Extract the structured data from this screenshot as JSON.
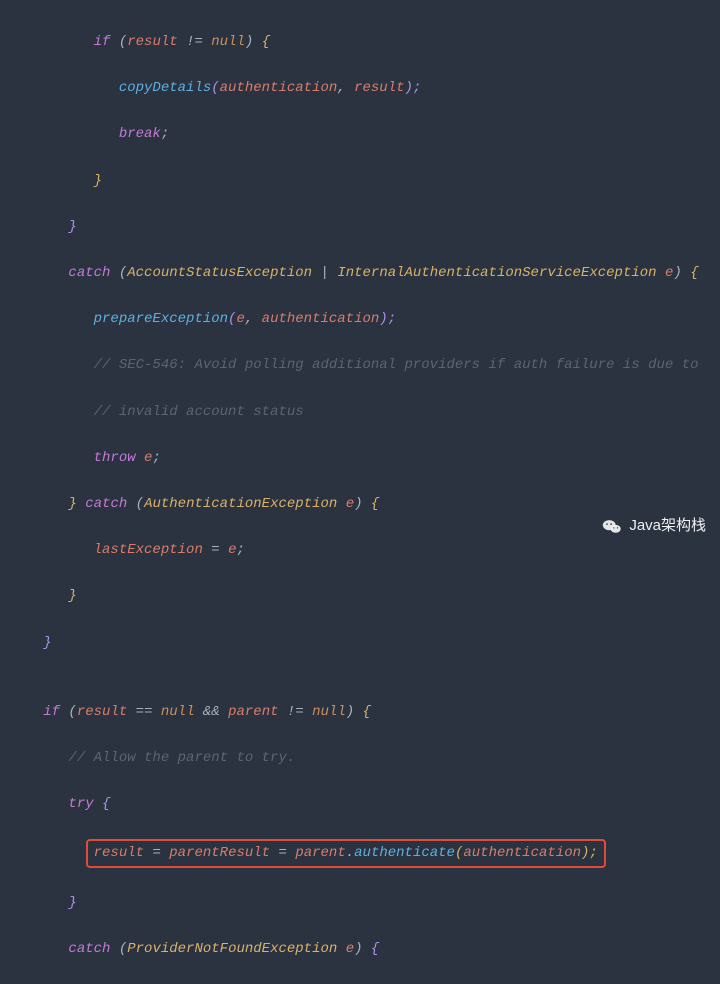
{
  "lines": {
    "l1": {
      "indent": 3,
      "kw": "if",
      "open": " (",
      "v1": "result",
      "op": " != ",
      "lit": "null",
      "close": ") ",
      "brace": "{"
    },
    "l2": {
      "indent": 4,
      "fn": "copyDetails",
      "open": "(",
      "a1": "authentication",
      "c": ", ",
      "a2": "result",
      "close": ");"
    },
    "l3": {
      "indent": 4,
      "kw": "break",
      "semi": ";"
    },
    "l4": {
      "indent": 3,
      "brace": "}"
    },
    "l5": {
      "indent": 2,
      "brace": "}"
    },
    "l6": {
      "indent": 2,
      "kw": "catch",
      "open": " (",
      "t1": "AccountStatusException",
      "pipe": " | ",
      "t2": "InternalAuthenticationServiceException",
      "sp": " ",
      "v": "e",
      "close": ") ",
      "brace": "{"
    },
    "l7": {
      "indent": 3,
      "fn": "prepareException",
      "open": "(",
      "a1": "e",
      "c": ", ",
      "a2": "authentication",
      "close": ");"
    },
    "l8": {
      "indent": 3,
      "cmt": "// SEC-546: Avoid polling additional providers if auth failure is due to"
    },
    "l9": {
      "indent": 3,
      "cmt": "// invalid account status"
    },
    "l10": {
      "indent": 3,
      "kw": "throw",
      "sp": " ",
      "v": "e",
      "semi": ";"
    },
    "l11": {
      "indent": 2,
      "cb": "}",
      "sp": " ",
      "kw": "catch",
      "open": " (",
      "t": "AuthenticationException",
      "sp2": " ",
      "v": "e",
      "close": ") ",
      "ob": "{"
    },
    "l12": {
      "indent": 3,
      "v1": "lastException",
      "op": " = ",
      "v2": "e",
      "semi": ";"
    },
    "l13": {
      "indent": 2,
      "brace": "}"
    },
    "l14": {
      "indent": 1,
      "brace": "}"
    },
    "l15": {
      "indent": 1,
      "blank": ""
    },
    "l16": {
      "indent": 1,
      "kw": "if",
      "open": " (",
      "v1": "result",
      "op1": " == ",
      "lit1": "null",
      "and": " && ",
      "v2": "parent",
      "op2": " != ",
      "lit2": "null",
      "close": ") ",
      "brace": "{"
    },
    "l17": {
      "indent": 2,
      "cmt": "// Allow the parent to try."
    },
    "l18": {
      "indent": 2,
      "kw": "try",
      "sp": " ",
      "brace": "{"
    },
    "l19": {
      "indent": 3,
      "v1": "result",
      "op1": " = ",
      "v2": "parentResult",
      "op2": " = ",
      "v3": "parent",
      "dot": ".",
      "fn": "authenticate",
      "open": "(",
      "a1": "authentication",
      "close": ");"
    },
    "l20": {
      "indent": 2,
      "brace": "}"
    },
    "l21": {
      "indent": 2,
      "kw": "catch",
      "open": " (",
      "t": "ProviderNotFoundException",
      "sp": " ",
      "v": "e",
      "close": ") ",
      "brace": "{"
    }
  },
  "watermark": {
    "label": "Java架构栈"
  }
}
